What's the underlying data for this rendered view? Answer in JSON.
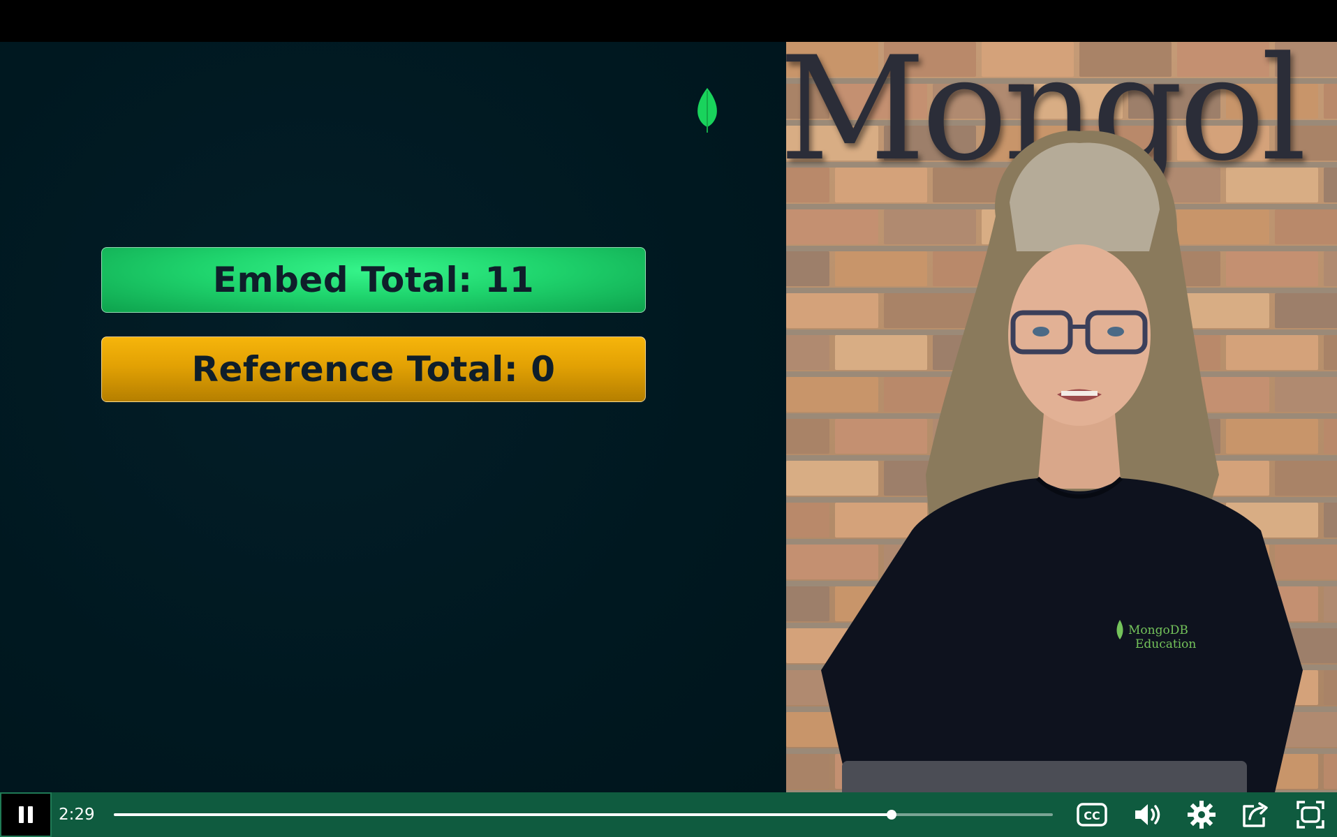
{
  "slide": {
    "embed_total": "Embed Total: 11",
    "reference_total": "Reference Total: 0"
  },
  "wall_sign": "Mongol",
  "shirt_logo": "MongoDB Education",
  "player": {
    "current_time": "2:29",
    "progress_fraction": 0.828,
    "buttons": [
      "pause",
      "captions",
      "volume",
      "settings",
      "share",
      "fullscreen"
    ]
  },
  "colors": {
    "control_bar": "#0f5b3f",
    "embed": "#1fd46d",
    "reference": "#e2a104",
    "slide_bg": "#001820"
  }
}
